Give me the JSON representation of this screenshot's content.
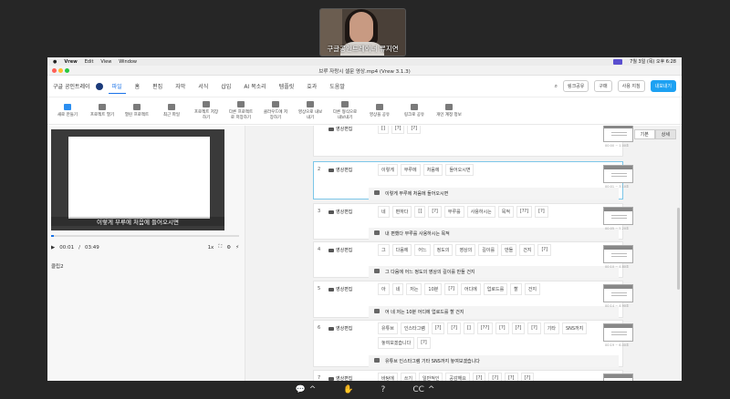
{
  "participant": {
    "name": "구글공인트레이너 류지연"
  },
  "menubar": {
    "items": [
      "Vrew",
      "Edit",
      "View",
      "Window"
    ],
    "clock": "7월 3일 (목) 오후 6:28"
  },
  "window": {
    "title": "브루 자랑시 셀문 영상.mp4 (Vrew 3.1.3)"
  },
  "header": {
    "project": "구글 공인트레이",
    "tabs": [
      "파일",
      "홈",
      "편집",
      "자막",
      "서식",
      "삽입",
      "AI 목소리",
      "템플릿",
      "효과",
      "도움말"
    ],
    "active_tab": "파일",
    "share": "링크공유",
    "buy": "구매",
    "guide": "사용 지침",
    "pro": "내보내기"
  },
  "toolbar": {
    "items": [
      "새로 만들기",
      "프로젝트 열기",
      "열린 프로젝트",
      "최근 파일",
      "프로젝트 저장하기",
      "다른 프로젝트로 저장하기",
      "클라우드에 저장하기",
      "영상으로 내보내기",
      "다른 형식으로 내보내기",
      "영상을 공유",
      "링크로 공유",
      "개인 계정 정보"
    ]
  },
  "video": {
    "subtitle": "이렇게 부루에 처음에 들어오시면",
    "time_current": "00:01",
    "time_total": "03:49",
    "speed": "1x"
  },
  "memo": {
    "label": "클립2"
  },
  "view_toggle": {
    "left": "기본",
    "right": "상세"
  },
  "segments": [
    {
      "num": "",
      "speaker": "영상편집",
      "words": [
        "[]",
        "[?]",
        "[?]"
      ],
      "sentence": "",
      "ts": "00:00 ~ 1.00초"
    },
    {
      "num": "2",
      "speaker": "영상편집",
      "words": [
        "이렇게",
        "부루에",
        "처음에",
        "들어오시면"
      ],
      "sentence": "이렇게 부루에 처음에 들어오시면",
      "ts": "00:01 ~ 3.10초"
    },
    {
      "num": "3",
      "speaker": "영상편집",
      "words": [
        "네",
        "편하다",
        "[]",
        "[?]",
        "부루를",
        "사용하시는",
        "목적",
        "[??]",
        "[?]"
      ],
      "sentence": "내 편했다 부루를 사용하시는 목적",
      "ts": "00:05 ~ 5.20초"
    },
    {
      "num": "4",
      "speaker": "영상편집",
      "words": [
        "그",
        "다음에",
        "어느",
        "정도의",
        "영상의",
        "길이를",
        "만들",
        "건지",
        "[?]"
      ],
      "sentence": "그 다음에 어느 정도의 영상의 길이를 만들 건지",
      "ts": "00:10 ~ 4.80초"
    },
    {
      "num": "5",
      "speaker": "영상편집",
      "words": [
        "아",
        "네",
        "저는",
        "10분",
        "[?]",
        "어디에",
        "업로드를",
        "할",
        "건지"
      ],
      "sentence": "어 네 저는 10분 어디에 업로드를 할 건지",
      "ts": "00:14 ~ 4.90초"
    },
    {
      "num": "6",
      "speaker": "영상편집",
      "words": [
        "유튜브",
        "인스타그램",
        "[?]",
        "[?]",
        "[]",
        "[??]",
        "[?]",
        "[?]",
        "[?]",
        "기타",
        "SNS까지",
        "놓여보겠습니다",
        "[?]"
      ],
      "sentence": "유튜브 인스타그램 기타 SNS까지 놓여보겠습니다",
      "ts": "00:19 ~ 6.00초"
    },
    {
      "num": "7",
      "speaker": "영상편집",
      "words": [
        "바탕에",
        "쓰기",
        "일반적인",
        "공감해요",
        "[?]",
        "[?]",
        "[?]",
        "[?]"
      ],
      "sentence": "",
      "ts": ""
    }
  ]
}
